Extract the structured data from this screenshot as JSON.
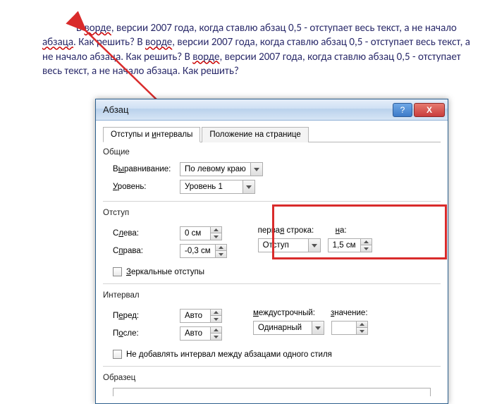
{
  "doc": {
    "segments": [
      "В ворде, версии 2007 года, когда ставлю абзац 0,5 - отступает весь текст, а не начало абзаца. Как решить? В ворде, версии 2007 года, когда ставлю абзац 0,5 - отступает весь текст, а не начало абзаца. Как решить? В ворде, версии 2007 года, когда ставлю абзац 0,5 - отступает весь текст, а не начало абзаца. Как решить?"
    ]
  },
  "dialog": {
    "title": "Абзац",
    "help": "?",
    "close": "X",
    "tabs": {
      "active": "Отступы и интервалы",
      "other": "Положение на странице"
    },
    "general": {
      "label": "Общие",
      "alignment_label": "Выравнивание:",
      "alignment_value": "По левому краю",
      "level_label": "Уровень:",
      "level_value": "Уровень 1"
    },
    "indent": {
      "label": "Отступ",
      "left_label": "Слева:",
      "left_value": "0 см",
      "right_label": "Справа:",
      "right_value": "-0,3 см",
      "mirror_label": "Зеркальные отступы",
      "firstline_label": "первая строка:",
      "firstline_value": "Отступ",
      "by_label": "на:",
      "by_value": "1,5 см"
    },
    "spacing": {
      "label": "Интервал",
      "before_label": "Перед:",
      "before_value": "Авто",
      "after_label": "После:",
      "after_value": "Авто",
      "line_label": "междустрочный:",
      "line_value": "Одинарный",
      "at_label": "значение:",
      "at_value": "",
      "noadd_label": "Не добавлять интервал между абзацами одного стиля"
    },
    "preview": {
      "label": "Образец"
    }
  }
}
